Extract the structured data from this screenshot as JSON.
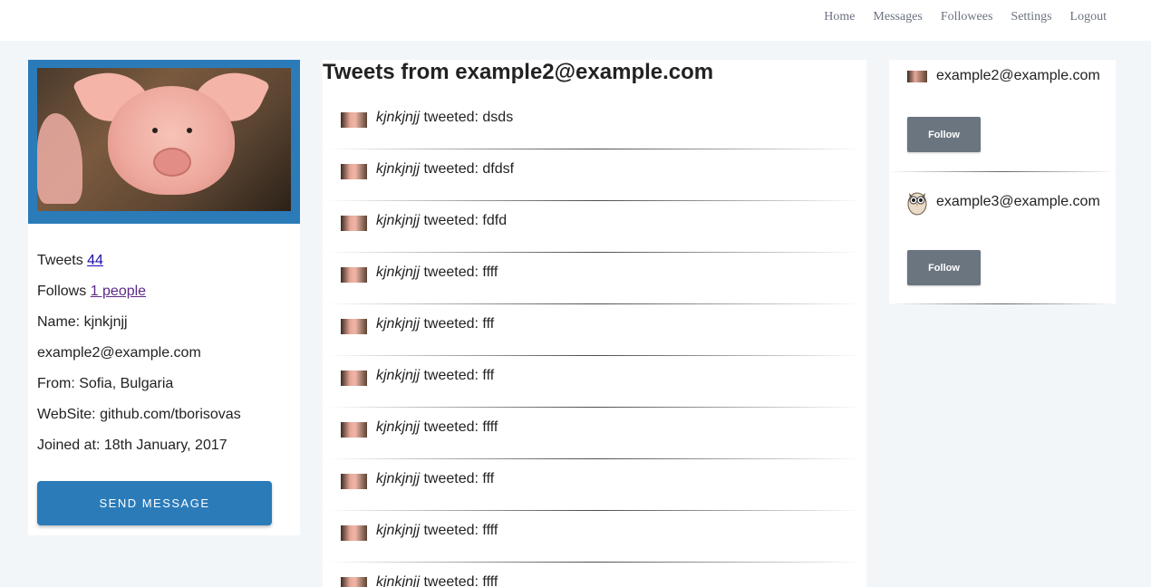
{
  "nav": {
    "items": [
      "Home",
      "Messages",
      "Followees",
      "Settings",
      "Logout"
    ]
  },
  "profile": {
    "tweets_label": "Tweets",
    "tweets_count": "44",
    "follows_label": "Follows",
    "follows_link": "1 people",
    "name": "Name: kjnkjnjj",
    "email": "example2@example.com",
    "from": "From: Sofia, Bulgaria",
    "website": "WebSite: github.com/tborisovas",
    "joined": "Joined at: 18th January, 2017",
    "send_message_label": "Send Message",
    "photo_icon": "pig-photo"
  },
  "tweets": {
    "heading": "Tweets from example2@example.com",
    "items": [
      {
        "author": "kjnkjnjj",
        "verb": "tweeted:",
        "text": "dsds"
      },
      {
        "author": "kjnkjnjj",
        "verb": "tweeted:",
        "text": "dfdsf"
      },
      {
        "author": "kjnkjnjj",
        "verb": "tweeted:",
        "text": "fdfd"
      },
      {
        "author": "kjnkjnjj",
        "verb": "tweeted:",
        "text": "ffff"
      },
      {
        "author": "kjnkjnjj",
        "verb": "tweeted:",
        "text": "fff"
      },
      {
        "author": "kjnkjnjj",
        "verb": "tweeted:",
        "text": "fff"
      },
      {
        "author": "kjnkjnjj",
        "verb": "tweeted:",
        "text": "ffff"
      },
      {
        "author": "kjnkjnjj",
        "verb": "tweeted:",
        "text": "fff"
      },
      {
        "author": "kjnkjnjj",
        "verb": "tweeted:",
        "text": "ffff"
      },
      {
        "author": "kjnkjnjj",
        "verb": "tweeted:",
        "text": "ffff"
      }
    ]
  },
  "followees": {
    "items": [
      {
        "email": "example2@example.com",
        "button": "Follow",
        "avatar": "pig-avatar"
      },
      {
        "email": "example3@example.com",
        "button": "Follow",
        "avatar": "owl-avatar"
      }
    ]
  },
  "colors": {
    "accent": "#2b7bb9",
    "follow_button": "#6b7580",
    "background": "#f3f6f9"
  }
}
